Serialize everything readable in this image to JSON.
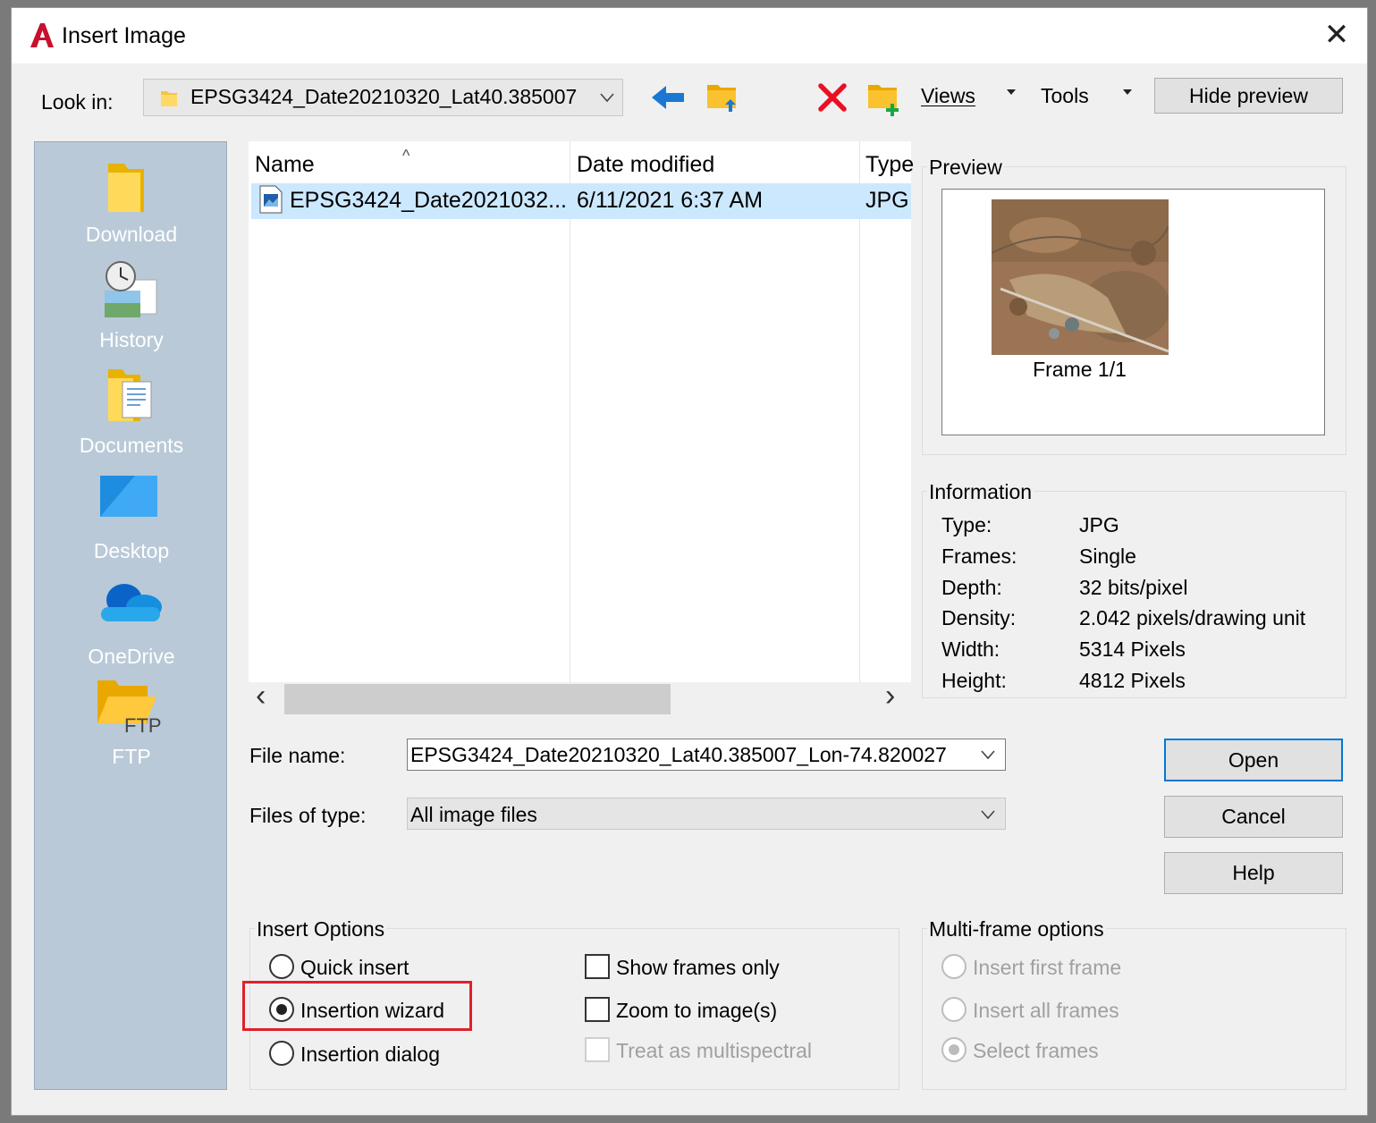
{
  "window": {
    "title": "Insert Image",
    "close_glyph": "✕"
  },
  "toolbar": {
    "look_in_label": "Look in:",
    "look_in_value": "EPSG3424_Date20210320_Lat40.385007",
    "views_label": "Views",
    "tools_label": "Tools",
    "hide_preview_label": "Hide preview"
  },
  "places": [
    {
      "label": "Download",
      "icon": "folder-icon"
    },
    {
      "label": "History",
      "icon": "history-icon"
    },
    {
      "label": "Documents",
      "icon": "documents-icon"
    },
    {
      "label": "Desktop",
      "icon": "desktop-icon"
    },
    {
      "label": "OneDrive",
      "icon": "onedrive-icon"
    },
    {
      "label": "FTP",
      "icon": "ftp-folder-icon",
      "icon_text": "FTP"
    }
  ],
  "file_list": {
    "columns": [
      "Name",
      "Date modified",
      "Type"
    ],
    "sort_glyph": "^",
    "rows": [
      {
        "name": "EPSG3424_Date2021032...",
        "date_modified": "6/11/2021 6:37 AM",
        "type": "JPG"
      }
    ],
    "scroll_left": "‹",
    "scroll_right": "›"
  },
  "preview": {
    "title": "Preview",
    "frame_label": "Frame 1/1"
  },
  "information": {
    "title": "Information",
    "rows": [
      {
        "label": "Type:",
        "value": "JPG"
      },
      {
        "label": "Frames:",
        "value": "Single"
      },
      {
        "label": "Depth:",
        "value": "32 bits/pixel"
      },
      {
        "label": "Density:",
        "value": "2.042 pixels/drawing unit"
      },
      {
        "label": "Width:",
        "value": "5314 Pixels"
      },
      {
        "label": "Height:",
        "value": "4812 Pixels"
      }
    ]
  },
  "form": {
    "file_name_label": "File name:",
    "file_name_value": "EPSG3424_Date20210320_Lat40.385007_Lon-74.820027",
    "files_of_type_label": "Files of type:",
    "files_of_type_value": "All image files"
  },
  "buttons": {
    "open": "Open",
    "cancel": "Cancel",
    "help": "Help"
  },
  "insert_options": {
    "title": "Insert Options",
    "radios": [
      {
        "label": "Quick insert",
        "checked": false
      },
      {
        "label": "Insertion wizard",
        "checked": true
      },
      {
        "label": "Insertion dialog",
        "checked": false
      }
    ],
    "checks": [
      {
        "label": "Show frames only",
        "checked": false,
        "enabled": true
      },
      {
        "label": "Zoom to image(s)",
        "checked": false,
        "enabled": true
      },
      {
        "label": "Treat as multispectral",
        "checked": false,
        "enabled": false
      }
    ]
  },
  "multi_frame": {
    "title": "Multi-frame options",
    "radios": [
      {
        "label": "Insert first frame",
        "checked": false,
        "enabled": false
      },
      {
        "label": "Insert all frames",
        "checked": false,
        "enabled": false
      },
      {
        "label": "Select frames",
        "checked": true,
        "enabled": false
      }
    ]
  },
  "colors": {
    "accent": "#0078d7",
    "highlight": "#e0202a",
    "selection": "#cce8ff"
  }
}
